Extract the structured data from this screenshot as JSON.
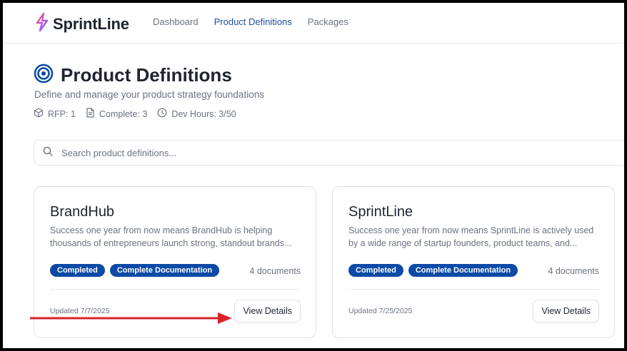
{
  "brand": {
    "name": "SprintLine"
  },
  "nav": [
    {
      "label": "Dashboard",
      "active": false
    },
    {
      "label": "Product Definitions",
      "active": true
    },
    {
      "label": "Packages",
      "active": false
    }
  ],
  "page": {
    "title": "Product Definitions",
    "subtitle": "Define and manage your product strategy foundations",
    "icon": "target-icon"
  },
  "stats": [
    {
      "icon": "cube-icon",
      "text": "RFP: 1"
    },
    {
      "icon": "document-icon",
      "text": "Complete: 3"
    },
    {
      "icon": "clock-icon",
      "text": "Dev Hours: 3/50"
    }
  ],
  "search": {
    "placeholder": "Search product definitions...",
    "value": ""
  },
  "cards": [
    {
      "title": "BrandHub",
      "description": "Success one year from now means BrandHub is helping thousands of entrepreneurs launch strong, standout brands...",
      "badges": [
        "Completed",
        "Complete Documentation"
      ],
      "documents": "4 documents",
      "updated": "Updated 7/7/2025",
      "button": "View Details"
    },
    {
      "title": "SprintLine",
      "description": "Success one year from now means SprintLine is actively used by a wide range of startup founders, product teams, and...",
      "badges": [
        "Completed",
        "Complete Documentation"
      ],
      "documents": "4 documents",
      "updated": "Updated 7/25/2025",
      "button": "View Details"
    }
  ],
  "colors": {
    "accent": "#1f4fa3",
    "badge": "#0c4aa6",
    "annotation_arrow": "#d9232a"
  }
}
